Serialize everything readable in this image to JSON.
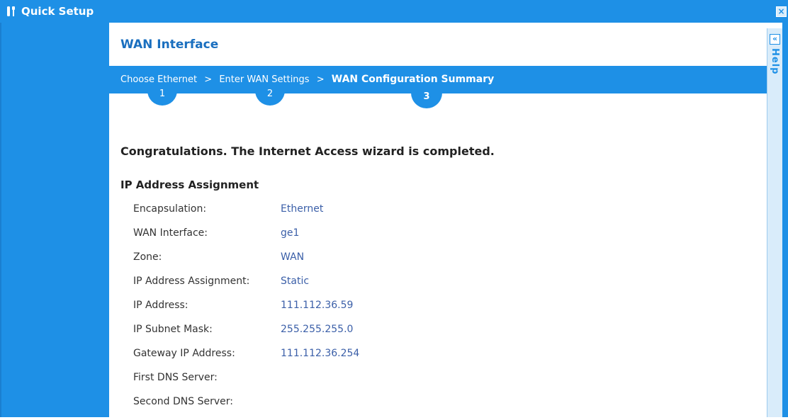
{
  "window": {
    "title": "Quick Setup",
    "close_label": "×"
  },
  "help": {
    "toggle_label": "«",
    "label": "Help"
  },
  "page": {
    "title": "WAN Interface"
  },
  "wizard": {
    "steps": [
      {
        "label": "Choose Ethernet",
        "number": "1"
      },
      {
        "label": "Enter WAN Settings",
        "number": "2"
      },
      {
        "label": "WAN Configuration Summary",
        "number": "3"
      }
    ],
    "separator": ">"
  },
  "content": {
    "heading": "Congratulations. The Internet Access wizard is completed.",
    "section_title": "IP Address Assignment",
    "rows": [
      {
        "label": "Encapsulation:",
        "value": "Ethernet"
      },
      {
        "label": "WAN Interface:",
        "value": "ge1"
      },
      {
        "label": "Zone:",
        "value": "WAN"
      },
      {
        "label": "IP Address Assignment:",
        "value": "Static"
      },
      {
        "label": "IP Address:",
        "value": "111.112.36.59"
      },
      {
        "label": "IP Subnet Mask:",
        "value": "255.255.255.0"
      },
      {
        "label": "Gateway IP Address:",
        "value": "111.112.36.254"
      },
      {
        "label": "First DNS Server:",
        "value": ""
      },
      {
        "label": "Second DNS Server:",
        "value": ""
      }
    ]
  },
  "colors": {
    "accent": "#1e90e6",
    "title_text": "#1a6fbf",
    "value_text": "#3b5fa8"
  },
  "icons": {
    "app": "wrench-settings-icon",
    "close": "close-icon",
    "help_toggle": "double-chevron-left-icon"
  }
}
